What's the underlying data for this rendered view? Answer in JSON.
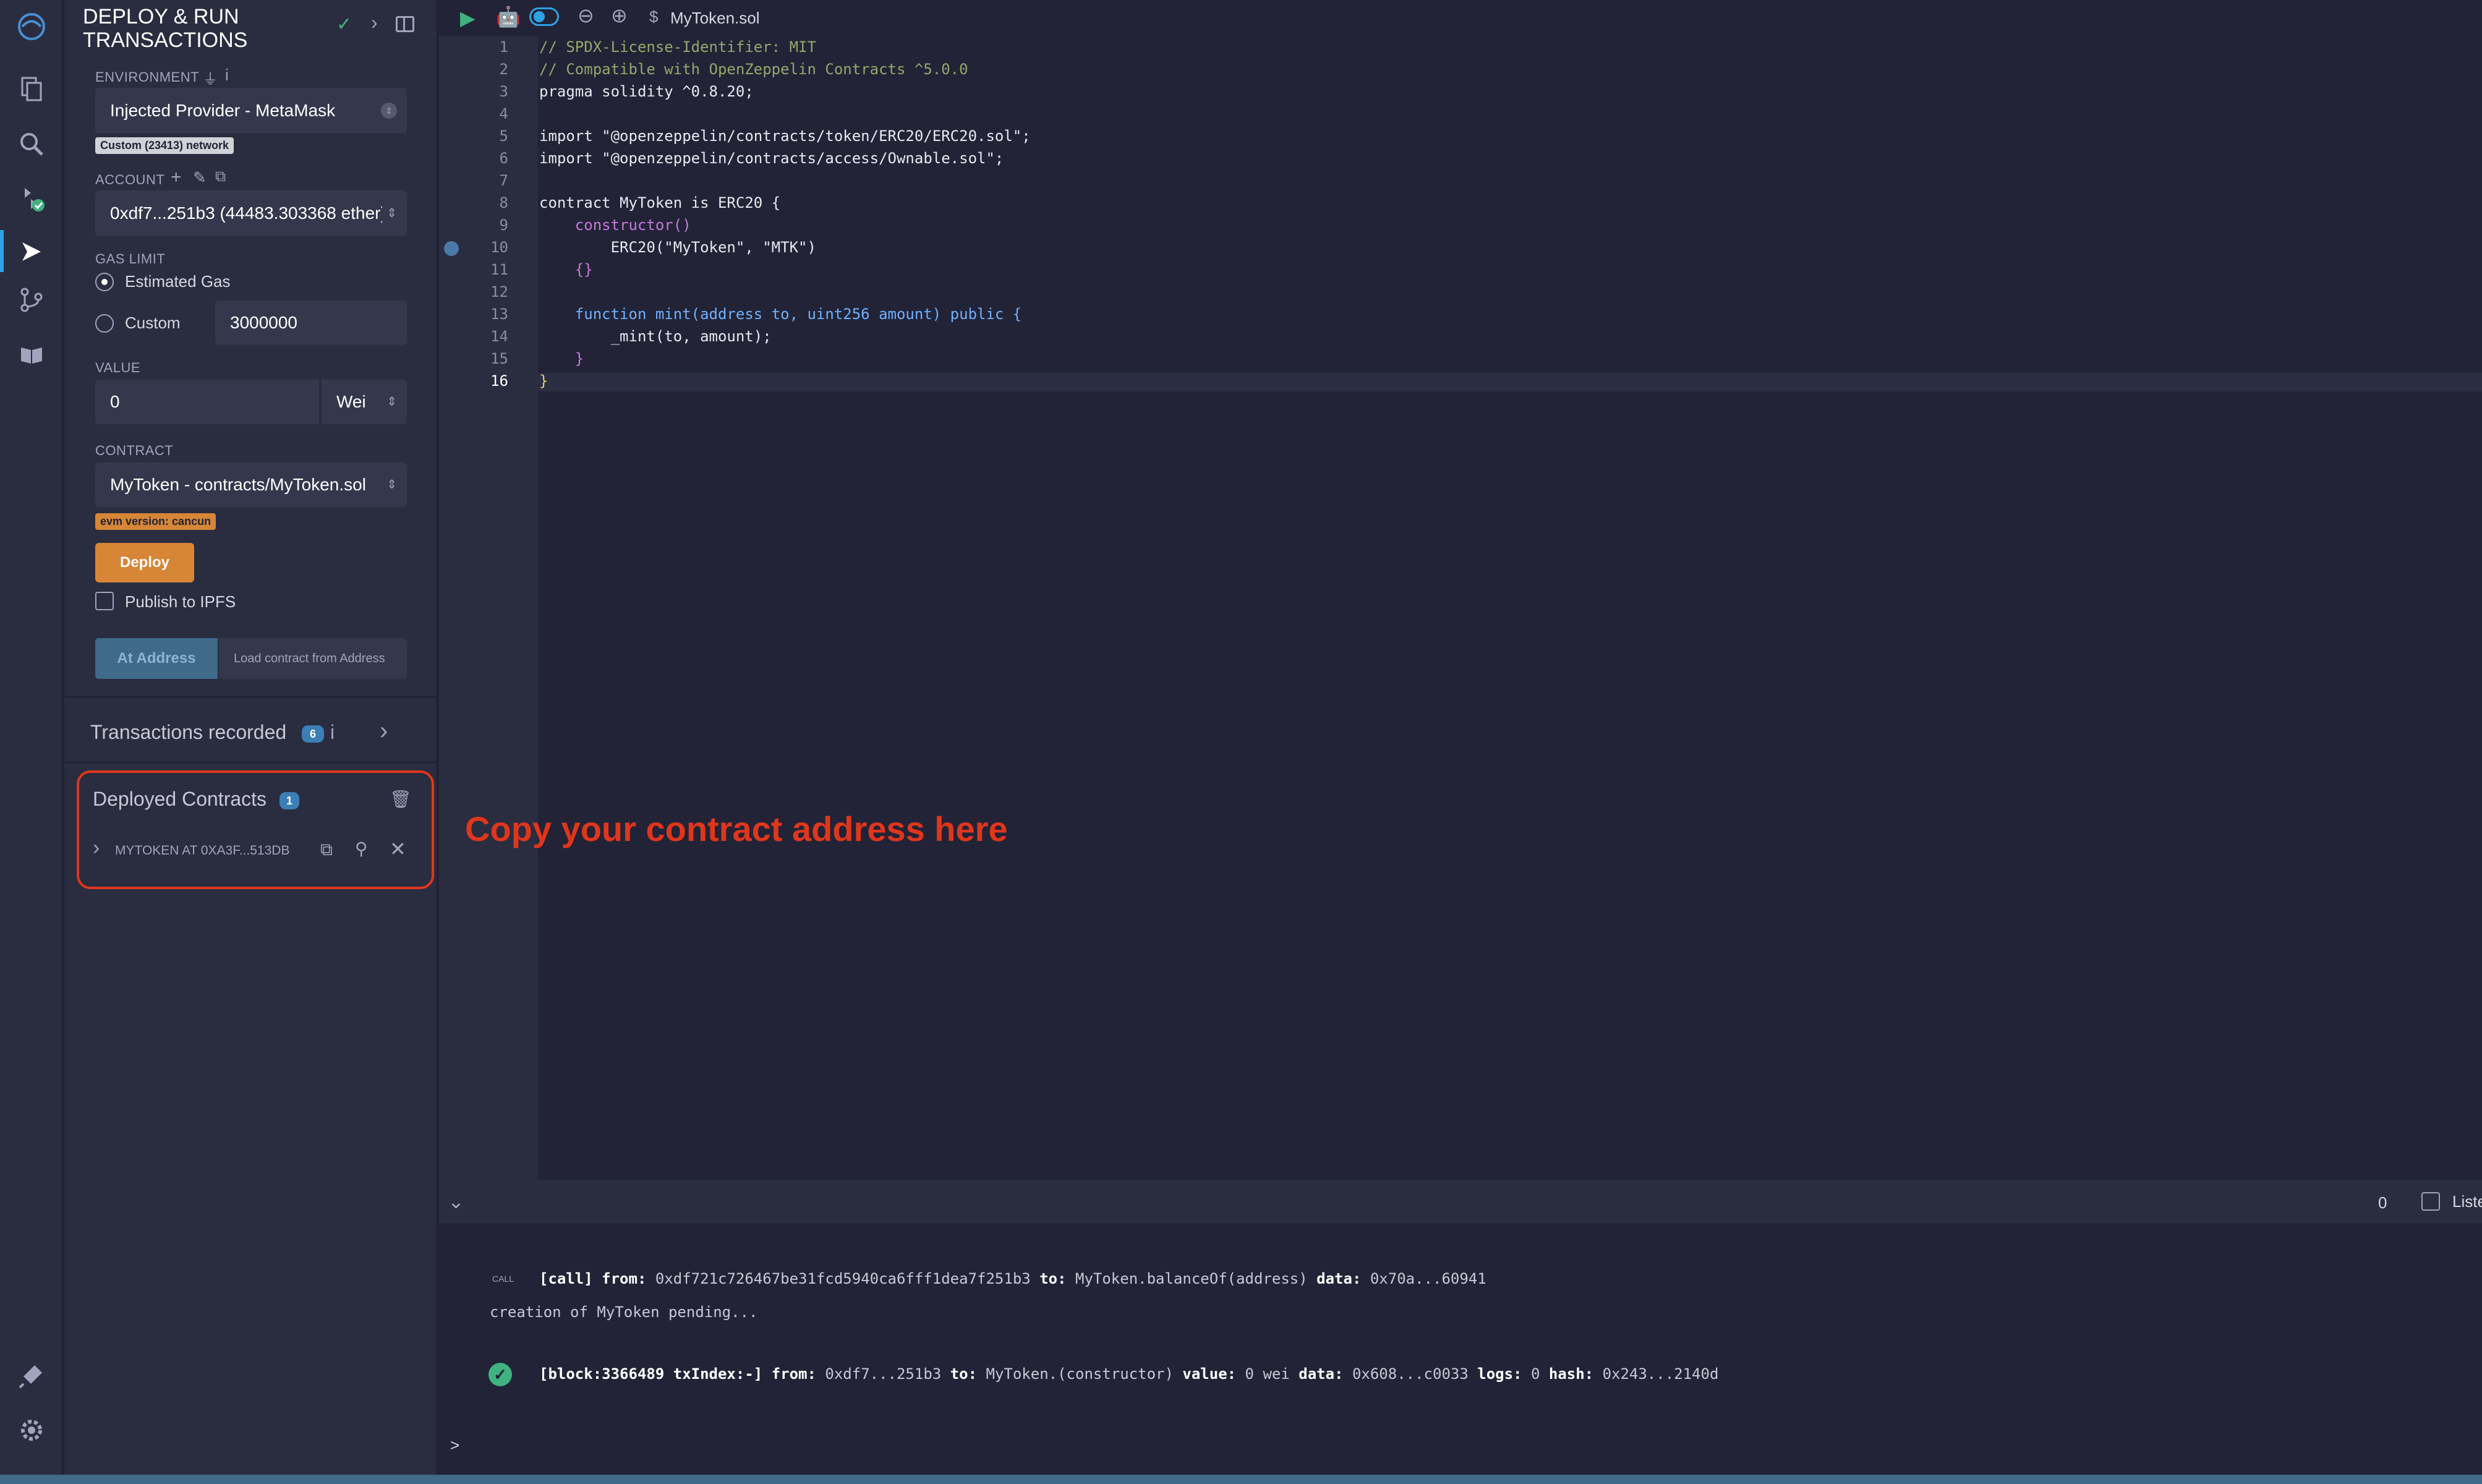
{
  "panel": {
    "title_line1": "DEPLOY & RUN",
    "title_line2": "TRANSACTIONS",
    "environment_label": "ENVIRONMENT",
    "environment_value": "Injected Provider - MetaMask",
    "network_badge": "Custom (23413) network",
    "account_label": "ACCOUNT",
    "account_value": "0xdf7...251b3 (44483.303368 ether)",
    "gas_limit_label": "GAS LIMIT",
    "estimated_gas_label": "Estimated Gas",
    "custom_label": "Custom",
    "custom_gas_value": "3000000",
    "value_label": "VALUE",
    "value_amount": "0",
    "value_unit": "Wei",
    "contract_label": "CONTRACT",
    "contract_value": "MyToken - contracts/MyToken.sol",
    "evm_badge": "evm version: cancun",
    "deploy_label": "Deploy",
    "publish_ipfs_label": "Publish to IPFS",
    "at_address_label": "At Address",
    "load_contract_placeholder": "Load contract from Address",
    "transactions_recorded_label": "Transactions recorded",
    "transactions_recorded_count": "6",
    "deployed_contracts_label": "Deployed Contracts",
    "deployed_contracts_count": "1",
    "deployed_instance_label": "MYTOKEN AT 0XA3F...513DB"
  },
  "toolbar": {
    "file_tab": "MyToken.sol"
  },
  "editor": {
    "line_numbers": [
      "1",
      "2",
      "3",
      "4",
      "5",
      "6",
      "7",
      "8",
      "9",
      "10",
      "11",
      "12",
      "13",
      "14",
      "15",
      "16"
    ],
    "lines": [
      "// SPDX-License-Identifier: MIT",
      "// Compatible with OpenZeppelin Contracts ^5.0.0",
      "pragma solidity ^0.8.20;",
      "",
      "import \"@openzeppelin/contracts/token/ERC20/ERC20.sol\";",
      "import \"@openzeppelin/contracts/access/Ownable.sol\";",
      "",
      "contract MyToken is ERC20 {",
      "    constructor()",
      "        ERC20(\"MyToken\", \"MTK\")",
      "    {}",
      "",
      "    function mint(address to, uint256 amount) public {",
      "        _mint(to, amount);",
      "    }",
      "}"
    ]
  },
  "annotation": {
    "text": "Copy your contract address here",
    "color": "#e0361c"
  },
  "terminal": {
    "count": "0",
    "listen_label": "Listen on all transactions",
    "call_tag": "CALL",
    "call_prefix": "[call]",
    "call_from_label": "from:",
    "call_from": "0xdf721c726467be31fcd5940ca6fff1dea7f251b3",
    "call_to_label": "to:",
    "call_to": "MyToken.balanceOf(address)",
    "call_data_label": "data:",
    "call_data": "0x70a...60941",
    "pending_text": "creation of MyToken pending...",
    "tx_block": "[block:3366489 txIndex:-]",
    "tx_from_label": "from:",
    "tx_from": "0xdf7...251b3",
    "tx_to_label": "to:",
    "tx_to": "MyToken.(constructor)",
    "tx_value_label": "value:",
    "tx_value": "0 wei",
    "tx_data_label": "data:",
    "tx_data": "0x608...c0033",
    "tx_logs_label": "logs:",
    "tx_logs": "0",
    "tx_hash_label": "hash:",
    "tx_hash": "0x243...2140d",
    "prompt": ">"
  },
  "colors": {
    "accent_blue": "#2ea2e6",
    "deploy_orange": "#d68636",
    "success_green": "#3fb27f"
  }
}
